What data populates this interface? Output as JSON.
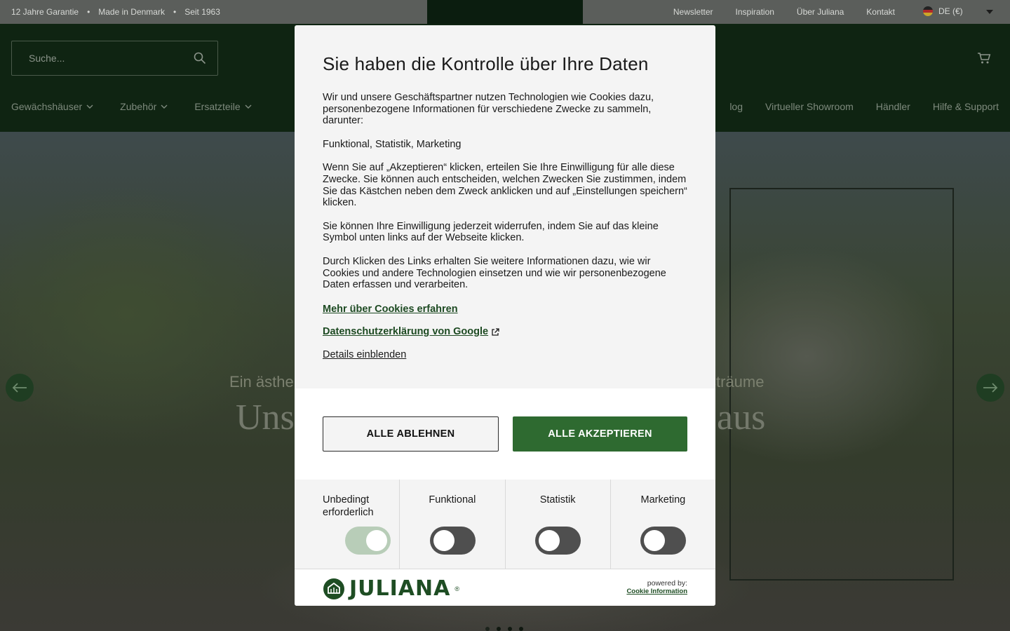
{
  "topbar": {
    "usps": [
      "12 Jahre Garantie",
      "Made in Denmark",
      "Seit 1963"
    ],
    "usp_separator": "•",
    "links": [
      "Newsletter",
      "Inspiration",
      "Über Juliana",
      "Kontakt"
    ],
    "language": "DE (€)"
  },
  "header": {
    "search_placeholder": "Suche...",
    "nav_left": [
      "Gewächshäuser",
      "Zubehör",
      "Ersatzteile"
    ],
    "nav_right": [
      "log",
      "Virtueller Showroom",
      "Händler",
      "Hilfe & Support"
    ]
  },
  "hero": {
    "subtitle_left": "Ein ästhe",
    "subtitle_right": "sträume",
    "title_left": "Uns",
    "title_right": "aus"
  },
  "cookie_modal": {
    "title": "Sie haben die Kontrolle über Ihre Daten",
    "paragraphs": [
      "Wir und unsere Geschäftspartner nutzen Technologien wie Cookies dazu, personenbezogene Informationen für verschiedene Zwecke zu sammeln, darunter:",
      "Funktional, Statistik, Marketing",
      "Wenn Sie auf „Akzeptieren“ klicken, erteilen Sie Ihre Einwilligung für alle diese Zwecke. Sie können auch entscheiden, welchen Zwecken Sie zustimmen, indem Sie das Kästchen neben dem Zweck anklicken und auf „Einstellungen speichern“ klicken.",
      "Sie können Ihre Einwilligung jederzeit widerrufen, indem Sie auf das kleine Symbol unten links auf der Webseite klicken.",
      "Durch Klicken des Links erhalten Sie weitere Informationen dazu, wie wir Cookies und andere Technologien einsetzen und wie wir personenbezogene Daten erfassen und verarbeiten."
    ],
    "link_cookies": "Mehr über Cookies erfahren",
    "link_google": "Datenschutzerklärung von Google",
    "link_details": "Details einblenden",
    "decline_label": "ALLE ABLEHNEN",
    "accept_label": "ALLE AKZEPTIEREN",
    "categories": [
      {
        "label": "Unbedingt erforderlich",
        "enabled": true
      },
      {
        "label": "Funktional",
        "enabled": false
      },
      {
        "label": "Statistik",
        "enabled": false
      },
      {
        "label": "Marketing",
        "enabled": false
      }
    ],
    "brand": "JULIANA",
    "brand_mark": "®",
    "powered_by": "powered by:",
    "provider": "Cookie Information"
  },
  "colors": {
    "brand_green": "#2e6a30",
    "header_dark": "#0f2412",
    "toggle_off": "#4f4f4f",
    "toggle_on": "#b8cdb8"
  }
}
